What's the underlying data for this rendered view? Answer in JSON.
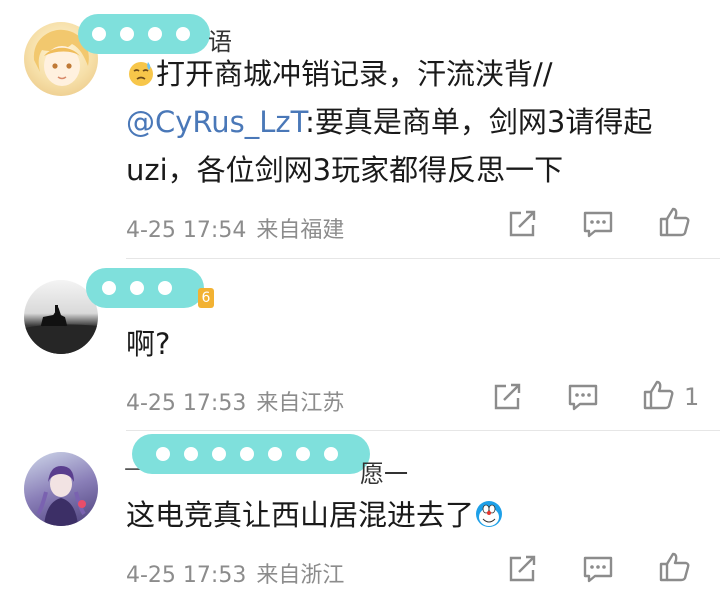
{
  "comments": [
    {
      "name_visible": "语",
      "emoji": "sweat-smile-emoji",
      "text_main": "打开商城冲销记录，汗流浃背//",
      "mention": "@CyRus_LzT",
      "text_rest": ":要真是商单，剑网3请得起uzi，各位剑网3玩家都得反思一下",
      "time": "4-25 17:54",
      "location": "来自福建",
      "likes": ""
    },
    {
      "name_visible": "6",
      "text_main": "啊?",
      "time": "4-25 17:53",
      "location": "来自江苏",
      "likes": "1"
    },
    {
      "name_visible": "愿一",
      "name_prefix": "—",
      "text_main": "这电竞真让西山居混进去了",
      "emoji": "doraemon-emoji",
      "time": "4-25 17:53",
      "location": "来自浙江",
      "likes": ""
    }
  ],
  "icons": {
    "share": "share-icon",
    "reply": "comment-icon",
    "like": "thumbs-up-icon"
  },
  "colors": {
    "mention": "#4a78b8",
    "meta": "#8c8c8c",
    "mask": "#7fe0dc"
  }
}
